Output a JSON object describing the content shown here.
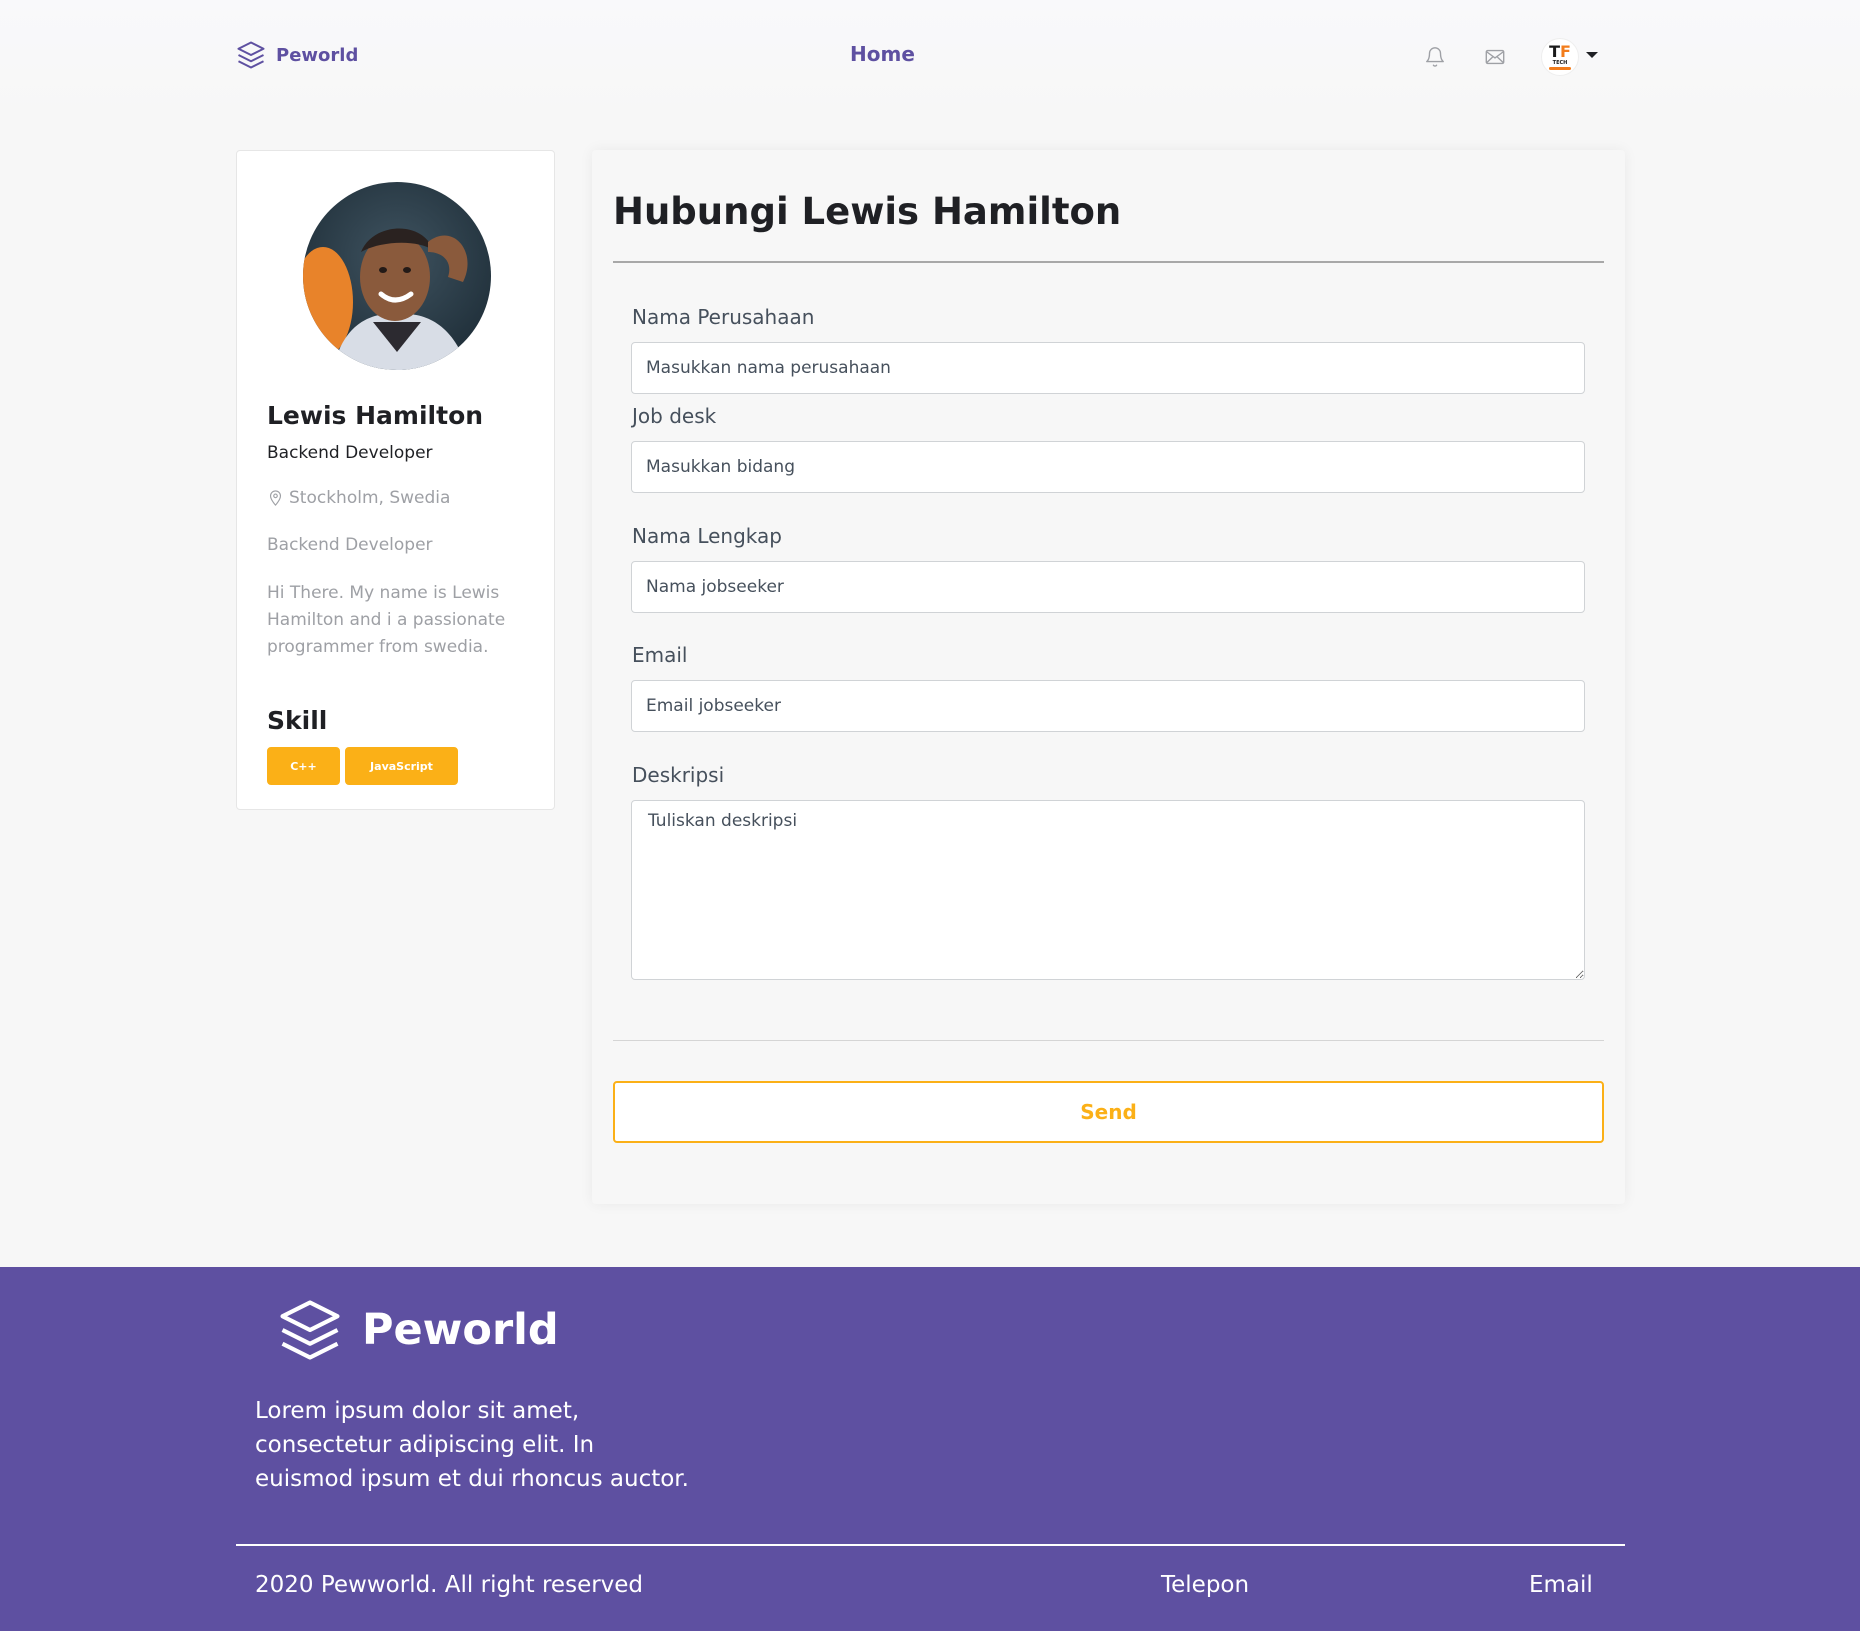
{
  "navbar": {
    "brand": "Peworld",
    "home_link": "Home",
    "user_avatar": {
      "logo_t": "T",
      "logo_f": "F",
      "logo_sub": "TECH"
    }
  },
  "profile": {
    "name": "Lewis Hamilton",
    "role": "Backend Developer",
    "location": "Stockholm, Swedia",
    "job_type": "Backend Developer",
    "bio": "Hi There. My name is Lewis Hamilton and i a passionate programmer from swedia.",
    "skill_title": "Skill",
    "skills": [
      "C++",
      "JavaScript"
    ]
  },
  "form": {
    "title": "Hubungi Lewis Hamilton",
    "company_label": "Nama Perusahaan",
    "company_placeholder": "Masukkan nama perusahaan",
    "jobdesk_label": "Job desk",
    "jobdesk_placeholder": "Masukkan bidang",
    "fullname_label": "Nama Lengkap",
    "fullname_placeholder": "Nama jobseeker",
    "email_label": "Email",
    "email_placeholder": "Email jobseeker",
    "description_label": "Deskripsi",
    "description_placeholder": "Tuliskan deskripsi",
    "send_label": "Send"
  },
  "footer": {
    "brand": "Peworld",
    "description": "Lorem ipsum dolor sit amet, consectetur adipiscing elit. In euismod ipsum et dui rhoncus auctor.",
    "copyright": "2020 Pewworld. All right reserved",
    "links": [
      "Telepon",
      "Email"
    ]
  },
  "colors": {
    "primary": "#5e50a1",
    "accent": "#fbb017",
    "background": "#f7f7f7"
  },
  "icons": {
    "brand": "layers-icon",
    "notifications": "bell-icon",
    "messages": "mail-icon",
    "location": "map-pin-icon",
    "dropdown": "caret-down-icon"
  }
}
